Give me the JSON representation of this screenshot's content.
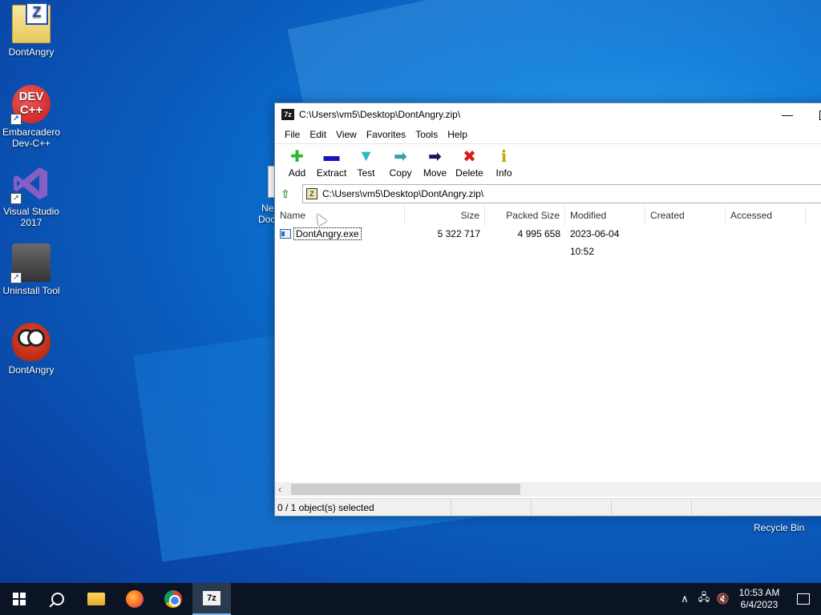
{
  "desktop": {
    "icons": [
      {
        "label": "DontAngry"
      },
      {
        "label": "Embarcadero Dev-C++",
        "glyph": "DEV C++"
      },
      {
        "label": "Visual Studio 2017"
      },
      {
        "label": "Uninstall Tool"
      },
      {
        "label": "DontAngry"
      }
    ],
    "hidden_item_label_1": "Ne",
    "hidden_item_label_2": "Doc",
    "recycle_bin_label": "Recycle Bin"
  },
  "window": {
    "title": "C:\\Users\\vm5\\Desktop\\DontAngry.zip\\",
    "app_icon_text": "7z",
    "minimize_glyph": "—",
    "menu": [
      "File",
      "Edit",
      "View",
      "Favorites",
      "Tools",
      "Help"
    ],
    "toolbar": [
      {
        "label": "Add",
        "icon": "plus-icon",
        "glyph": "✚",
        "color": "#2db52d"
      },
      {
        "label": "Extract",
        "icon": "minus-icon",
        "glyph": "▬",
        "color": "#1515b8"
      },
      {
        "label": "Test",
        "icon": "check-arrow-icon",
        "glyph": "▼",
        "color": "#2fb8c9"
      },
      {
        "label": "Copy",
        "icon": "copy-arrow-icon",
        "glyph": "➡",
        "color": "#3aa39b"
      },
      {
        "label": "Move",
        "icon": "move-arrow-icon",
        "glyph": "➡",
        "color": "#151560"
      },
      {
        "label": "Delete",
        "icon": "delete-x-icon",
        "glyph": "✖",
        "color": "#d81c1c"
      },
      {
        "label": "Info",
        "icon": "info-icon",
        "glyph": "ℹ",
        "color": "#c8a700"
      }
    ],
    "address": "C:\\Users\\vm5\\Desktop\\DontAngry.zip\\",
    "columns": {
      "name": "Name",
      "size": "Size",
      "packed": "Packed Size",
      "modified": "Modified",
      "created": "Created",
      "accessed": "Accessed"
    },
    "files": [
      {
        "name": "DontAngry.exe",
        "size": "5 322 717",
        "packed": "4 995 658",
        "modified": "2023-06-04 10:52",
        "created": "",
        "accessed": ""
      }
    ],
    "status": "0 / 1 object(s) selected",
    "scroll_left_glyph": "‹"
  },
  "taskbar": {
    "time": "10:53 AM",
    "date": "6/4/2023",
    "tray_up_glyph": "∧",
    "tray_network_glyph": "🖧",
    "tray_volume_glyph": "🔇",
    "sevenzip_text": "7z"
  }
}
